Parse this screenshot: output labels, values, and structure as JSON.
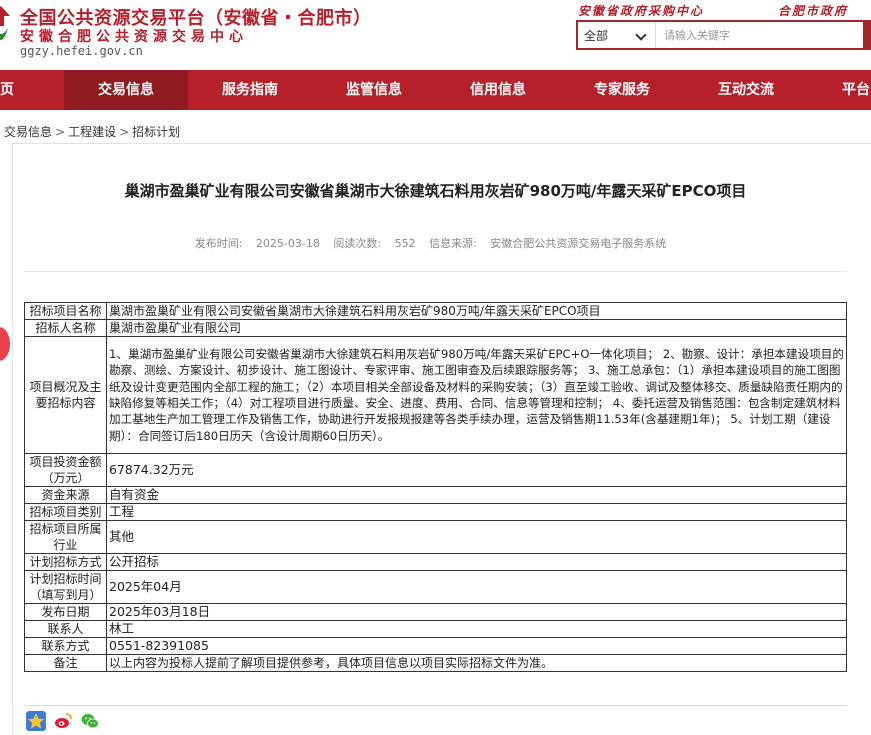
{
  "header": {
    "title": "全国公共资源交易平台（安徽省・合肥市）",
    "subtitle": "安徽合肥公共资源交易中心",
    "url": "ggzy.hefei.gov.cn",
    "toplinks": [
      "安徽省政府采购中心",
      "合肥市政府"
    ],
    "search": {
      "selected": "全部",
      "placeholder": "请输入关键字"
    }
  },
  "nav": {
    "items": [
      "页",
      "交易信息",
      "服务指南",
      "监管信息",
      "信用信息",
      "专家服务",
      "互动交流",
      "平台"
    ],
    "active_index": 1
  },
  "breadcrumb": [
    "交易信息",
    "工程建设",
    "招标计划"
  ],
  "article": {
    "title": "巢湖市盈巢矿业有限公司安徽省巢湖市大徐建筑石料用灰岩矿980万吨/年露天采矿EPCO项目",
    "meta": {
      "publish_label": "发布时间:",
      "publish_date": "2025-03-18",
      "views_label": "阅读次数:",
      "views": "552",
      "source_label": "信息来源:",
      "source": "安徽合肥公共资源交易电子服务系统"
    }
  },
  "table": {
    "rows": [
      {
        "key": "招标项目名称",
        "value": "巢湖市盈巢矿业有限公司安徽省巢湖市大徐建筑石料用灰岩矿980万吨/年露天采矿EPCO项目"
      },
      {
        "key": "招标人名称",
        "value": "巢湖市盈巢矿业有限公司"
      },
      {
        "key": "项目概况及主要招标内容",
        "value": "1、巢湖市盈巢矿业有限公司安徽省巢湖市大徐建筑石料用灰岩矿980万吨/年露天采矿EPC+O一体化项目； 2、勘察、设计：承担本建设项目的勘察、测绘、方案设计、初步设计、施工图设计、专家评审、施工图审查及后续跟踪服务等； 3、施工总承包：（1）承担本建设项目的施工图图纸及设计变更范围内全部工程的施工；（2）本项目相关全部设备及材料的采购安装；（3）直至竣工验收、调试及整体移交、质量缺陷责任期内的缺陷修复等相关工作；（4）对工程项目进行质量、安全、进度、费用、合同、信息等管理和控制； 4、委托运营及销售范围：包含制定建筑材料加工基地生产加工管理工作及销售工作，协助进行开发报规报建等各类手续办理，运营及销售期11.53年(含基建期1年)； 5、计划工期（建设期）：合同签订后180日历天（含设计周期60日历天）。"
      },
      {
        "key": "项目投资金额（万元）",
        "value": "67874.32万元"
      },
      {
        "key": "资金来源",
        "value": "自有资金"
      },
      {
        "key": "招标项目类别",
        "value": "工程"
      },
      {
        "key": "招标项目所属行业",
        "value": "其他"
      },
      {
        "key": "计划招标方式",
        "value": "公开招标"
      },
      {
        "key": "计划招标时间（填写到月）",
        "value": "2025年04月"
      },
      {
        "key": "发布日期",
        "value": "2025年03月18日"
      },
      {
        "key": "联系人",
        "value": "林工"
      },
      {
        "key": "联系方式",
        "value": "0551-82391085"
      },
      {
        "key": "备注",
        "value": "以上内容为投标人提前了解项目提供参考，具体项目信息以项目实际招标文件为准。"
      }
    ]
  },
  "share_icons": [
    "qzone-icon",
    "weibo-icon",
    "wechat-icon"
  ],
  "colors": {
    "brand": "#b5202a",
    "nav_active": "#8f1a20"
  }
}
